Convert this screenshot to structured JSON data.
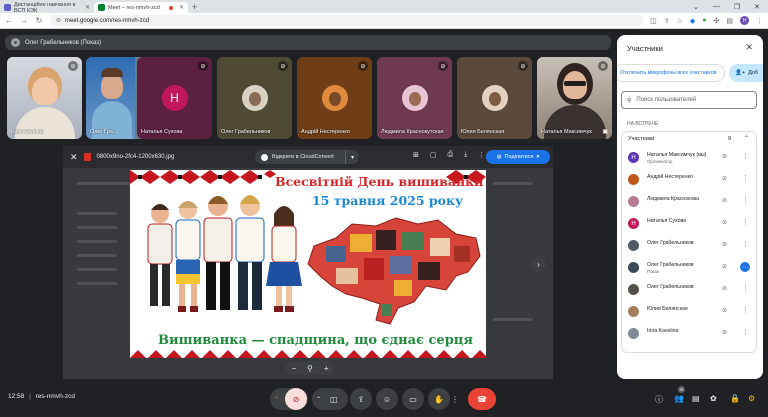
{
  "browser": {
    "tabs": [
      {
        "label": "Дистанційне навчання в ВСП КЭК",
        "favicon_color": "#5b5fc7",
        "active": false
      },
      {
        "label": "Meet – res-nmvh-zcd",
        "favicon_color": "#00832d",
        "active": true
      }
    ],
    "url": "meet.google.com/res-nmvh-zcd",
    "profile_initial": "H"
  },
  "presenter": {
    "label": "Олег Грабельников (Показ)"
  },
  "tiles": [
    {
      "name": "Irina Kavelina",
      "type": "video",
      "color": "#7a8aa0"
    },
    {
      "name": "Олег Гра...",
      "type": "video",
      "color": "#6b7a8d"
    },
    {
      "name": "Наталья Сухова",
      "type": "avatar",
      "initial": "Н",
      "color": "#c2185b",
      "bg": "#5c2040"
    },
    {
      "name": "Олег Грабельников",
      "type": "photo",
      "color": "#5d5a45",
      "bg": "#4e4a34"
    },
    {
      "name": "Андрій Нестеренко",
      "type": "photo",
      "color": "#b3561c",
      "bg": "#6f3e16"
    },
    {
      "name": "Людмила Краснокутская",
      "type": "photo",
      "color": "#c98fa8",
      "bg": "#6f3a50"
    },
    {
      "name": "Юлия Белянская",
      "type": "photo",
      "color": "#c0a080",
      "bg": "#5b4a3b"
    },
    {
      "name": "Наталья Максимчук",
      "type": "video",
      "color": "#9e8b7a"
    }
  ],
  "viewer": {
    "filename": "0800x9no-2fc4-1200x630.jpg",
    "open_with": "Відкрити в CloudConvert",
    "share": "Поділитися"
  },
  "poster": {
    "title1": "Всесвітній День вишиванки",
    "title2": "15 травня 2025 року",
    "slogan": "Вишиванка — спадщина, що єднає серця"
  },
  "bottom": {
    "time": "12:58",
    "meeting_code": "res-nmvh-zcd",
    "participant_badge": "9"
  },
  "panel": {
    "title": "Участники",
    "mute_all": "Отключить микрофоны всех участников",
    "add": "Доб",
    "search_placeholder": "Поиск пользователей",
    "section": "НА ВСТРЕЧЕ",
    "list_header": "Участники",
    "count": "9",
    "participants": [
      {
        "name": "Наталья Максимчук (вы)",
        "role": "Организатор",
        "initial": "Н",
        "color": "#5e35b1"
      },
      {
        "name": "Андрій Нестеренко",
        "role": "",
        "initial": "",
        "color": "#c2571a"
      },
      {
        "name": "Людмила Краснокова",
        "role": "",
        "initial": "",
        "color": "#b77b93"
      },
      {
        "name": "Наталья Сухова",
        "role": "",
        "initial": "Н",
        "color": "#c2185b"
      },
      {
        "name": "Олег Грабельников",
        "role": "",
        "initial": "",
        "color": "#4f5b66"
      },
      {
        "name": "Олег Грабельников",
        "role": "Показ",
        "initial": "",
        "color": "#3c4a5a"
      },
      {
        "name": "Олег Грабельников",
        "role": "",
        "initial": "",
        "color": "#56504a"
      },
      {
        "name": "Юлия Белянская",
        "role": "",
        "initial": "",
        "color": "#a67d5c"
      },
      {
        "name": "Irina Kavelina",
        "role": "",
        "initial": "",
        "color": "#7f8a9b"
      }
    ]
  }
}
